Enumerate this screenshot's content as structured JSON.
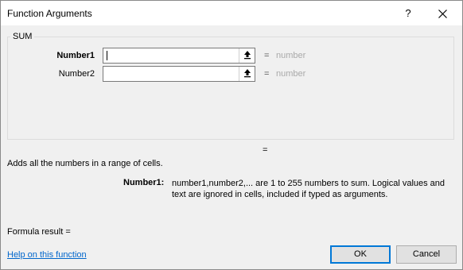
{
  "window": {
    "title": "Function Arguments",
    "help": "?"
  },
  "function_name": "SUM",
  "args": [
    {
      "label": "Number1",
      "value": "",
      "result_eq": "=",
      "result": "number"
    },
    {
      "label": "Number2",
      "value": "",
      "result_eq": "=",
      "result": "number"
    }
  ],
  "result_eq": "=",
  "description": "Adds all the numbers in a range of cells.",
  "detail": {
    "label": "Number1:",
    "text": "number1,number2,... are 1 to 255 numbers to sum. Logical values and text are ignored in cells, included if typed as arguments."
  },
  "formula_result": "Formula result =",
  "help_link": "Help on this function",
  "buttons": {
    "ok": "OK",
    "cancel": "Cancel"
  },
  "icons": {
    "close": "close-icon",
    "ref": "collapse-dialog-icon"
  }
}
